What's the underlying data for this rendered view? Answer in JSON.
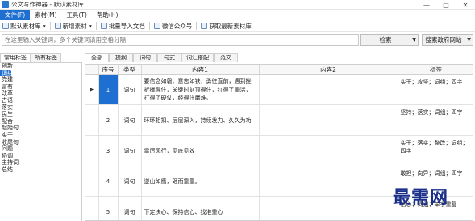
{
  "window": {
    "title": "公文写作神器 - 默认素材库",
    "min": "—",
    "max": "□",
    "close": "✕"
  },
  "menu": [
    "文件(F)",
    "素材(M)",
    "工具(T)",
    "帮助(H)"
  ],
  "toolbar": {
    "default_lib": "默认素材库",
    "new_material": "新增素材",
    "batch_import": "批量导入文档",
    "wechat": "微信公众号",
    "fetch_latest": "获取最新素材库"
  },
  "search": {
    "placeholder": "在这里输入关键词，多个关键词请用空格分隔",
    "search_button": "检索",
    "gov_button": "搜索政府网站"
  },
  "sidebar": {
    "tabs": [
      "常用标签",
      "所有标签"
    ],
    "items": [
      "创新",
      "词组",
      "党建",
      "富有",
      "改革",
      "古语",
      "落实",
      "民生",
      "配合",
      "起始句",
      "实干",
      "收尾句",
      "问题",
      "协调",
      "主持词",
      "总结"
    ],
    "selected_index": 1
  },
  "main_tabs": [
    "全部",
    "提纲",
    "词句",
    "句式",
    "词汇搭配",
    "范文"
  ],
  "table": {
    "headers": [
      "序号",
      "类型",
      "内容1",
      "内容2",
      "标签"
    ],
    "rows": [
      {
        "indicator": "▶",
        "no": "1",
        "type": "词句",
        "content1": "要信念如磐、意志如铁，勇往直前，遇到挫折撑得住，关键时刻顶得住，扛得了重活，打得了硬仗，经得住磨难。",
        "content2": "",
        "tags": "实干；攻坚；词组；四字"
      },
      {
        "indicator": "",
        "no": "2",
        "type": "词句",
        "content1": "环环相扣、层层深入，持续发力、久久为功",
        "content2": "",
        "tags": "坚持；落实；词组；四字"
      },
      {
        "indicator": "",
        "no": "3",
        "type": "词句",
        "content1": "雷厉风行，见底见效",
        "content2": "",
        "tags": "实干；落实；整改；词组；四字"
      },
      {
        "indicator": "",
        "no": "4",
        "type": "词句",
        "content1": "逆山如鹰，砸而靠靠。",
        "content2": "",
        "tags": "敢担；向异；词组；四字"
      },
      {
        "indicator": "",
        "no": "5",
        "type": "词句",
        "content1": "下定决心、保持信心、找准重心",
        "content2": "",
        "tags": "信心；词组；单字重复"
      }
    ]
  },
  "watermark": "最需网"
}
